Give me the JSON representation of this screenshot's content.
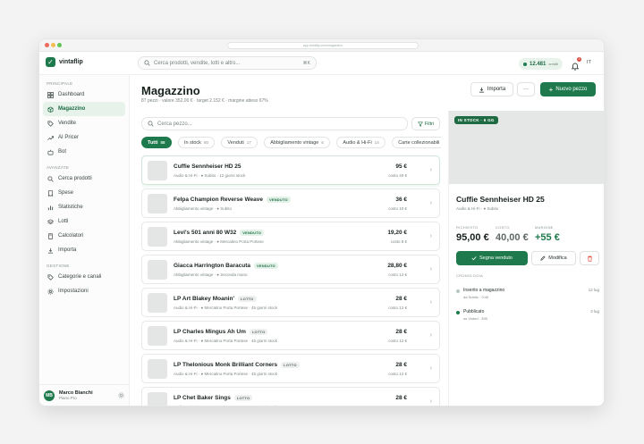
{
  "browser": {
    "url": "app.vintaflip.com/magazzino"
  },
  "app": {
    "name": "vintaflip",
    "logo_glyph": "✓"
  },
  "topbar": {
    "search_placeholder": "Cerca prodotti, vendite, lotti e altro...",
    "search_shortcut": "⌘K",
    "credits_value": "12.481",
    "credits_unit": "crediti",
    "notifications_count": "3",
    "language": "IT"
  },
  "sidebar": {
    "section_main": "PRINCIPALE",
    "main_items": [
      {
        "label": "Dashboard",
        "icon": "grid-icon"
      },
      {
        "label": "Magazzino",
        "icon": "box-icon",
        "active": true
      },
      {
        "label": "Vendite",
        "icon": "tag-icon"
      },
      {
        "label": "AI Pricer",
        "icon": "trend-icon"
      },
      {
        "label": "Bot",
        "icon": "bot-icon"
      }
    ],
    "section_advanced": "AVANZATE",
    "advanced_items": [
      {
        "label": "Cerca prodotti",
        "icon": "search-icon"
      },
      {
        "label": "Spese",
        "icon": "receipt-icon"
      },
      {
        "label": "Statistiche",
        "icon": "chart-icon"
      },
      {
        "label": "Lotti",
        "icon": "layers-icon"
      },
      {
        "label": "Calcolatori",
        "icon": "calculator-icon"
      },
      {
        "label": "Importa",
        "icon": "download-icon"
      }
    ],
    "section_manage": "GESTIONE",
    "manage_items": [
      {
        "label": "Categorie e canali",
        "icon": "tag-icon"
      },
      {
        "label": "Impostazioni",
        "icon": "gear-icon"
      }
    ],
    "user": {
      "initials": "MB",
      "name": "Marco Bianchi",
      "plan": "Piano Pro"
    }
  },
  "main": {
    "title": "Magazzino",
    "subtitle": "87 pezzi · valore 352,00 € · target 2.152 € · margine atteso 67%",
    "import_label": "Importa",
    "more_label": "···",
    "new_label": "Nuovo pezzo",
    "search_placeholder": "Cerca pezzo...",
    "filter_label": "Filtri",
    "chips": [
      {
        "label": "Tutti",
        "count": "88",
        "active": true
      },
      {
        "label": "In stock",
        "count": "80"
      },
      {
        "label": "Venduti",
        "count": "17"
      },
      {
        "label": "Abbigliamento vintage",
        "count": "6"
      },
      {
        "label": "Audio & Hi-Fi",
        "count": "14"
      },
      {
        "label": "Carte collezionabili",
        "count": "3"
      }
    ],
    "rows": [
      {
        "name": "Cuffie Sennheiser HD 25",
        "tag": "",
        "meta": "Audio & Hi-Fi · ● Subito · 12 giorni stock",
        "price": "95 €",
        "cost": "costo 40 €",
        "selected": true
      },
      {
        "name": "Felpa Champion Reverse Weave",
        "tag": "VENDUTO",
        "tag_type": "v",
        "meta": "Abbigliamento vintage · ● Subito",
        "price": "36 €",
        "cost": "costo 10 €"
      },
      {
        "name": "Levi's 501 anni 80 W32",
        "tag": "VENDUTO",
        "tag_type": "v",
        "meta": "Abbigliamento vintage · ● Mercatino Porta Portese",
        "price": "19,20 €",
        "cost": "costo 8 €"
      },
      {
        "name": "Giacca Harrington Baracuta",
        "tag": "VENDUTO",
        "tag_type": "v",
        "meta": "Abbigliamento vintage · ● Seconda mano",
        "price": "28,80 €",
        "cost": "costo 12 €"
      },
      {
        "name": "LP Art Blakey Moanin'",
        "tag": "LOTTO",
        "tag_type": "l",
        "meta": "Audio & Hi-Fi · ● Mercatino Porta Portese · 45 giorni stock",
        "price": "28 €",
        "cost": "costo 12 €"
      },
      {
        "name": "LP Charles Mingus Ah Um",
        "tag": "LOTTO",
        "tag_type": "l",
        "meta": "Audio & Hi-Fi · ● Mercatino Porta Portese · 45 giorni stock",
        "price": "28 €",
        "cost": "costo 12 €"
      },
      {
        "name": "LP Thelonious Monk Brilliant Corners",
        "tag": "LOTTO",
        "tag_type": "l",
        "meta": "Audio & Hi-Fi · ● Mercatino Porta Portese · 45 giorni stock",
        "price": "28 €",
        "cost": "costo 12 €"
      },
      {
        "name": "LP Chet Baker Sings",
        "tag": "LOTTO",
        "tag_type": "l",
        "meta": "Audio & Hi-Fi · ● Mercatino Porta Portese · 45 giorni stock",
        "price": "28 €",
        "cost": "costo 12 €"
      }
    ]
  },
  "detail": {
    "badge": "IN STOCK · 6 GG",
    "name": "Cuffie Sennheiser HD 25",
    "meta": "Audio & Hi-Fi · ● Subito",
    "asking_label": "RICHIESTO",
    "asking_value": "95,00 €",
    "cost_label": "COSTO",
    "cost_value": "40,00 €",
    "margin_label": "MARGINE",
    "margin_value": "+55 €",
    "sell_label": "Segna venduto",
    "edit_label": "Modifica",
    "timeline_label": "CRONOLOGIA",
    "timeline": [
      {
        "title": "Inserito a magazzino",
        "sub": "da Subito · 0:40",
        "date": "12 lug"
      },
      {
        "title": "Pubblicato",
        "sub": "su Vinted · 395",
        "date": "3 lug"
      }
    ]
  },
  "colors": {
    "accent": "#1e7a4c",
    "accent_light": "#e6f2ea",
    "danger": "#d94a3a"
  }
}
